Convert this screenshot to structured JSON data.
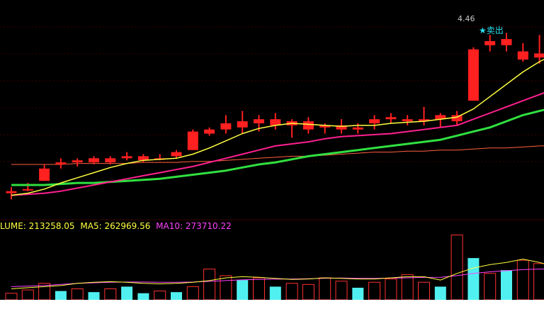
{
  "colors": {
    "background": "#000000",
    "up_candle": "#ff2020",
    "down_candle": "#ff2020",
    "ma5": "#ffff40",
    "ma10": "#ff2090",
    "ma20": "#30e040",
    "ma60": "#ff6040",
    "volume_up": "#ff3030",
    "volume_down": "#50f0f0",
    "grid": "#3a0000",
    "legend_volume": "#ffff40",
    "legend_ma5": "#ffff40",
    "legend_ma10": "#ff40ff"
  },
  "legend": {
    "volume": "LUME: 213258.05",
    "ma5": "MA5: 262969.56",
    "ma10": "MA10: 273710.22"
  },
  "annotations": {
    "high_price": "4.46",
    "sell_signal": "★卖出"
  },
  "chart_data": [
    {
      "type": "candlestick",
      "ylim": [
        2.6,
        4.6
      ],
      "grid": true,
      "candles": [
        {
          "o": 2.72,
          "h": 2.78,
          "l": 2.66,
          "c": 2.74
        },
        {
          "o": 2.76,
          "h": 2.82,
          "l": 2.74,
          "c": 2.76
        },
        {
          "o": 2.84,
          "h": 3.0,
          "l": 2.84,
          "c": 2.96
        },
        {
          "o": 3.0,
          "h": 3.06,
          "l": 2.96,
          "c": 3.02
        },
        {
          "o": 3.02,
          "h": 3.06,
          "l": 2.98,
          "c": 3.04
        },
        {
          "o": 3.06,
          "h": 3.08,
          "l": 3.0,
          "c": 3.02
        },
        {
          "o": 3.02,
          "h": 3.08,
          "l": 3.0,
          "c": 3.06
        },
        {
          "o": 3.08,
          "h": 3.12,
          "l": 3.04,
          "c": 3.06
        },
        {
          "o": 3.04,
          "h": 3.1,
          "l": 3.02,
          "c": 3.08
        },
        {
          "o": 3.06,
          "h": 3.1,
          "l": 3.04,
          "c": 3.06
        },
        {
          "o": 3.08,
          "h": 3.14,
          "l": 3.06,
          "c": 3.12
        },
        {
          "o": 3.14,
          "h": 3.34,
          "l": 3.14,
          "c": 3.32
        },
        {
          "o": 3.34,
          "h": 3.36,
          "l": 3.28,
          "c": 3.3
        },
        {
          "o": 3.34,
          "h": 3.48,
          "l": 3.3,
          "c": 3.4
        },
        {
          "o": 3.42,
          "h": 3.52,
          "l": 3.3,
          "c": 3.36
        },
        {
          "o": 3.4,
          "h": 3.48,
          "l": 3.32,
          "c": 3.44
        },
        {
          "o": 3.44,
          "h": 3.5,
          "l": 3.34,
          "c": 3.38
        },
        {
          "o": 3.38,
          "h": 3.44,
          "l": 3.26,
          "c": 3.42
        },
        {
          "o": 3.42,
          "h": 3.46,
          "l": 3.3,
          "c": 3.34
        },
        {
          "o": 3.36,
          "h": 3.4,
          "l": 3.3,
          "c": 3.38
        },
        {
          "o": 3.38,
          "h": 3.44,
          "l": 3.3,
          "c": 3.34
        },
        {
          "o": 3.34,
          "h": 3.4,
          "l": 3.3,
          "c": 3.36
        },
        {
          "o": 3.4,
          "h": 3.48,
          "l": 3.34,
          "c": 3.44
        },
        {
          "o": 3.44,
          "h": 3.5,
          "l": 3.4,
          "c": 3.46
        },
        {
          "o": 3.44,
          "h": 3.48,
          "l": 3.38,
          "c": 3.42
        },
        {
          "o": 3.44,
          "h": 3.56,
          "l": 3.38,
          "c": 3.42
        },
        {
          "o": 3.44,
          "h": 3.5,
          "l": 3.36,
          "c": 3.48
        },
        {
          "o": 3.48,
          "h": 3.52,
          "l": 3.38,
          "c": 3.42
        },
        {
          "o": 3.62,
          "h": 4.14,
          "l": 3.62,
          "c": 4.12
        },
        {
          "o": 4.16,
          "h": 4.26,
          "l": 4.1,
          "c": 4.2
        },
        {
          "o": 4.22,
          "h": 4.28,
          "l": 4.1,
          "c": 4.16
        },
        {
          "o": 4.1,
          "h": 4.18,
          "l": 4.0,
          "c": 4.02
        },
        {
          "o": 4.04,
          "h": 4.26,
          "l": 3.98,
          "c": 4.08
        },
        {
          "o": 4.1,
          "h": 4.46,
          "l": 4.06,
          "c": 4.14
        },
        {
          "o": 4.16,
          "h": 4.22,
          "l": 4.06,
          "c": 4.1
        }
      ],
      "signal_candle": {
        "o": 4.12,
        "h": 4.16,
        "l": 3.74,
        "c": 3.74
      },
      "ma5": [
        2.7,
        2.72,
        2.76,
        2.82,
        2.87,
        2.92,
        2.97,
        3.01,
        3.04,
        3.05,
        3.06,
        3.1,
        3.16,
        3.23,
        3.3,
        3.35,
        3.38,
        3.4,
        3.39,
        3.38,
        3.37,
        3.38,
        3.38,
        3.4,
        3.41,
        3.42,
        3.44,
        3.46,
        3.54,
        3.66,
        3.78,
        3.9,
        4.0,
        4.08,
        4.12
      ],
      "ma10": [
        2.7,
        2.71,
        2.72,
        2.74,
        2.77,
        2.8,
        2.83,
        2.86,
        2.89,
        2.92,
        2.95,
        2.98,
        3.02,
        3.06,
        3.1,
        3.14,
        3.18,
        3.2,
        3.22,
        3.25,
        3.27,
        3.28,
        3.29,
        3.3,
        3.32,
        3.34,
        3.36,
        3.38,
        3.44,
        3.5,
        3.56,
        3.62,
        3.68,
        3.74,
        3.82
      ],
      "ma20": [
        2.8,
        2.8,
        2.8,
        2.81,
        2.82,
        2.82,
        2.83,
        2.84,
        2.85,
        2.86,
        2.88,
        2.9,
        2.92,
        2.94,
        2.97,
        3.0,
        3.02,
        3.05,
        3.08,
        3.1,
        3.12,
        3.14,
        3.16,
        3.18,
        3.2,
        3.22,
        3.24,
        3.28,
        3.32,
        3.36,
        3.42,
        3.48,
        3.52,
        3.56,
        3.6
      ],
      "ma60": [
        3.0,
        3.0,
        3.0,
        3.0,
        3.01,
        3.01,
        3.01,
        3.01,
        3.02,
        3.02,
        3.02,
        3.03,
        3.03,
        3.04,
        3.05,
        3.06,
        3.07,
        3.08,
        3.08,
        3.09,
        3.1,
        3.11,
        3.12,
        3.12,
        3.13,
        3.13,
        3.14,
        3.14,
        3.15,
        3.16,
        3.16,
        3.17,
        3.18,
        3.18,
        3.19
      ]
    },
    {
      "type": "bar",
      "ylim": [
        0,
        600000
      ],
      "volumes": [
        {
          "v": 60000,
          "up": true
        },
        {
          "v": 90000,
          "up": true
        },
        {
          "v": 150000,
          "up": true
        },
        {
          "v": 80000,
          "up": false
        },
        {
          "v": 100000,
          "up": true
        },
        {
          "v": 70000,
          "up": false
        },
        {
          "v": 100000,
          "up": true
        },
        {
          "v": 120000,
          "up": false
        },
        {
          "v": 60000,
          "up": false
        },
        {
          "v": 80000,
          "up": true
        },
        {
          "v": 70000,
          "up": false
        },
        {
          "v": 120000,
          "up": true
        },
        {
          "v": 280000,
          "up": true
        },
        {
          "v": 220000,
          "up": true
        },
        {
          "v": 180000,
          "up": false
        },
        {
          "v": 200000,
          "up": true
        },
        {
          "v": 120000,
          "up": false
        },
        {
          "v": 150000,
          "up": true
        },
        {
          "v": 140000,
          "up": true
        },
        {
          "v": 200000,
          "up": true
        },
        {
          "v": 170000,
          "up": true
        },
        {
          "v": 110000,
          "up": false
        },
        {
          "v": 160000,
          "up": true
        },
        {
          "v": 190000,
          "up": true
        },
        {
          "v": 230000,
          "up": true
        },
        {
          "v": 160000,
          "up": true
        },
        {
          "v": 120000,
          "up": false
        },
        {
          "v": 590000,
          "up": true
        },
        {
          "v": 380000,
          "up": false
        },
        {
          "v": 240000,
          "up": true
        },
        {
          "v": 270000,
          "up": false
        },
        {
          "v": 360000,
          "up": true
        },
        {
          "v": 330000,
          "up": true
        },
        {
          "v": 200000,
          "up": false
        },
        {
          "v": 213258.05,
          "up": false,
          "dotted": true
        }
      ],
      "ma5": [
        100000,
        110000,
        120000,
        130000,
        150000,
        160000,
        165000,
        160000,
        150000,
        145000,
        150000,
        160000,
        175000,
        200000,
        210000,
        205000,
        195000,
        185000,
        190000,
        200000,
        195000,
        190000,
        190000,
        200000,
        210000,
        210000,
        180000,
        240000,
        290000,
        320000,
        340000,
        370000,
        340000,
        300000,
        262969.56
      ],
      "ma10": [
        120000,
        125000,
        130000,
        140000,
        150000,
        155000,
        160000,
        162000,
        162000,
        160000,
        160000,
        162000,
        168000,
        175000,
        182000,
        186000,
        188000,
        190000,
        192000,
        196000,
        198000,
        196000,
        195000,
        198000,
        200000,
        204000,
        205000,
        220000,
        240000,
        255000,
        265000,
        275000,
        280000,
        278000,
        273710.22
      ]
    }
  ]
}
